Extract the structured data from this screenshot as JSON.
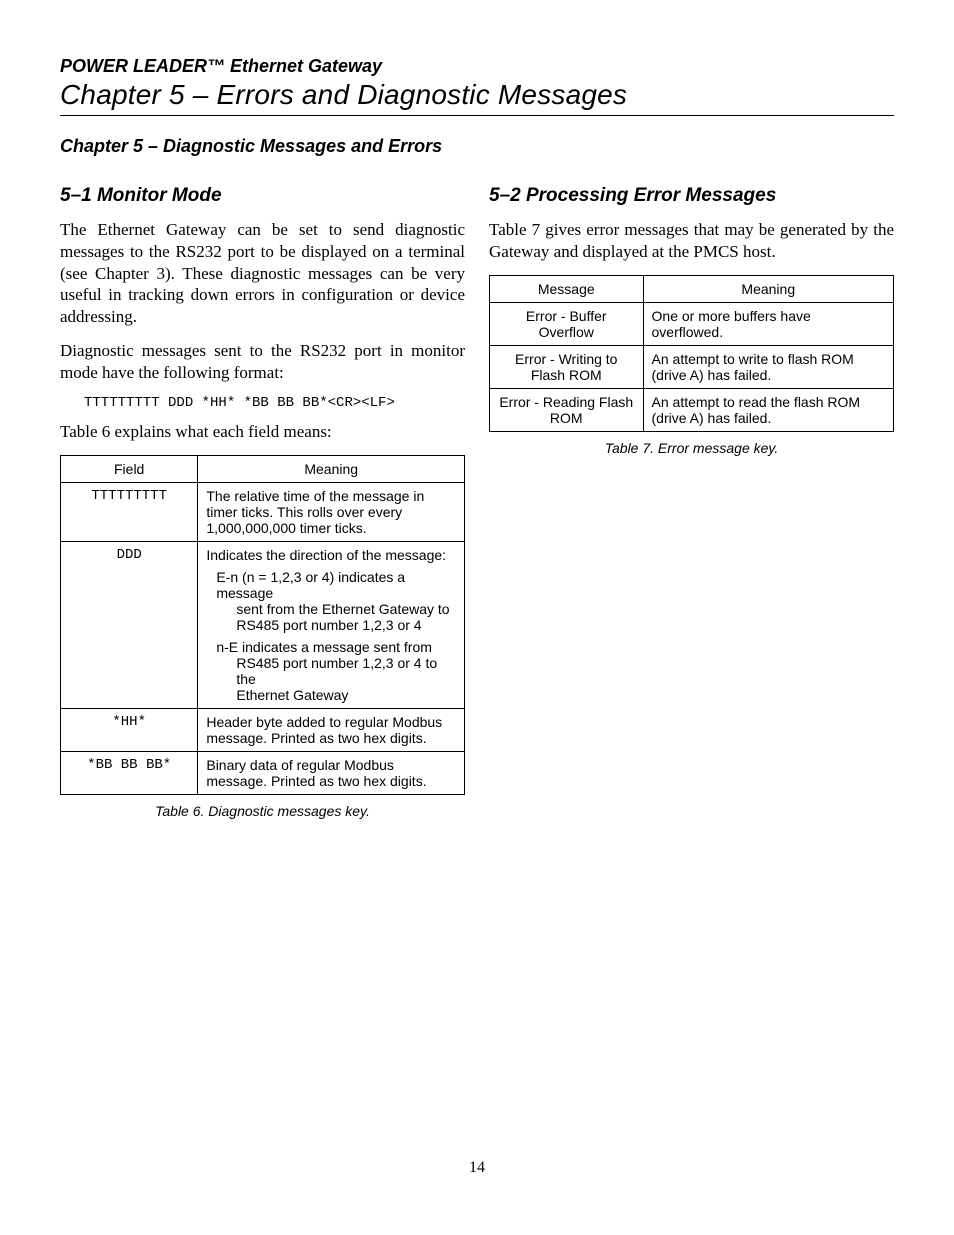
{
  "running_head": "POWER LEADER™ Ethernet Gateway",
  "chapter_title": "Chapter 5 – Errors and Diagnostic Messages",
  "subchapter": "Chapter 5 – Diagnostic Messages and Errors",
  "left": {
    "heading": "5–1 Monitor Mode",
    "para1": "The Ethernet Gateway can be set to send diagnostic messages to the RS232 port to be displayed on a terminal (see Chapter 3). These diagnostic messages can be very useful in tracking down errors in configuration or device addressing.",
    "para2": "Diagnostic messages sent to the RS232 port in monitor mode have the following format:",
    "format_line": "TTTTTTTTT DDD *HH* *BB BB BB*<CR><LF>",
    "para3": "Table 6 explains what each field means:",
    "table6": {
      "col1": "Field",
      "col2": "Meaning",
      "rows": [
        {
          "field": "TTTTTTTTT",
          "meaning": "The relative time of the message in timer ticks. This rolls over every 1,000,000,000 timer ticks."
        },
        {
          "field": "DDD",
          "meaning_line1": "Indicates the direction of the message:",
          "meaning_sub1a": "E-n (n = 1,2,3 or 4) indicates a message",
          "meaning_sub1b": "sent from the Ethernet Gateway to",
          "meaning_sub1c": "RS485 port number 1,2,3 or 4",
          "meaning_sub2a": "n-E indicates a message sent from",
          "meaning_sub2b": "RS485 port number 1,2,3 or 4 to the",
          "meaning_sub2c": "Ethernet Gateway"
        },
        {
          "field": "*HH*",
          "meaning": "Header byte added to regular Modbus message. Printed as two hex digits."
        },
        {
          "field": "*BB BB BB*",
          "meaning": "Binary data of regular Modbus message. Printed as two hex digits."
        }
      ],
      "caption": "Table 6. Diagnostic messages key."
    }
  },
  "right": {
    "heading": "5–2 Processing Error Messages",
    "para1": "Table 7 gives error messages that may be generated by the Gateway and displayed at the PMCS host.",
    "table7": {
      "col1": "Message",
      "col2": "Meaning",
      "rows": [
        {
          "message": "Error - Buffer Overflow",
          "meaning": "One or more buffers have overflowed."
        },
        {
          "message": "Error - Writing to Flash ROM",
          "meaning": "An attempt to write to flash ROM (drive A) has failed."
        },
        {
          "message": "Error - Reading Flash ROM",
          "meaning": "An attempt to read the flash ROM (drive A) has failed."
        }
      ],
      "caption": "Table 7. Error message key."
    }
  },
  "page_number": "14"
}
